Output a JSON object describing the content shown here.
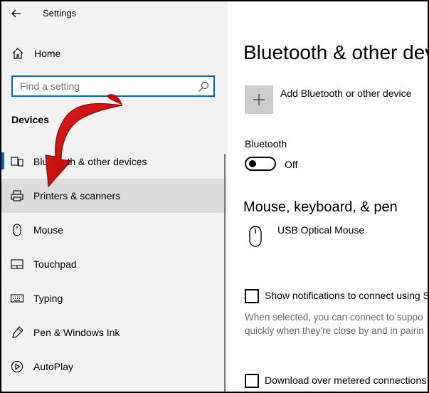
{
  "window": {
    "title": "Settings"
  },
  "sidebar": {
    "home_label": "Home",
    "search_placeholder": "Find a setting",
    "section_title": "Devices",
    "items": [
      {
        "label": "Bluetooth & other devices",
        "icon": "bluetooth-devices-icon"
      },
      {
        "label": "Printers & scanners",
        "icon": "printer-icon",
        "selected": true
      },
      {
        "label": "Mouse",
        "icon": "mouse-icon"
      },
      {
        "label": "Touchpad",
        "icon": "touchpad-icon"
      },
      {
        "label": "Typing",
        "icon": "keyboard-icon"
      },
      {
        "label": "Pen & Windows Ink",
        "icon": "pen-icon"
      },
      {
        "label": "AutoPlay",
        "icon": "autoplay-icon"
      }
    ]
  },
  "main": {
    "page_title": "Bluetooth & other dev",
    "add_device_label": "Add Bluetooth or other device",
    "bluetooth_label": "Bluetooth",
    "bluetooth_state": "Off",
    "mouse_section_title": "Mouse, keyboard, & pen",
    "device_name": "USB Optical Mouse",
    "notify_checkbox_label": "Show notifications to connect using S",
    "notify_description_line1": "When selected, you can connect to suppo",
    "notify_description_line2": "quickly when they're close by and in pairin",
    "metered_checkbox_label": "Download over metered connections"
  },
  "colors": {
    "accent": "#0067c0",
    "sidebar_bg": "#f2f2f2",
    "selected_bg": "#dcdcdc",
    "annotation_arrow": "#c00000"
  }
}
